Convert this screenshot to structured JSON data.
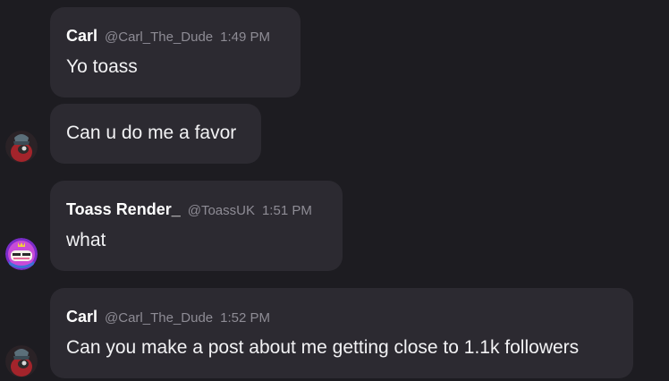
{
  "messages": [
    {
      "name": "Carl",
      "handle": "@Carl_The_Dude",
      "time": "1:49 PM",
      "text": "Yo toass"
    },
    {
      "text": "Can u do me a favor"
    },
    {
      "name": "Toass Render_",
      "handle": "@ToassUK",
      "time": "1:51 PM",
      "text": "what"
    },
    {
      "name": "Carl",
      "handle": "@Carl_The_Dude",
      "time": "1:52 PM",
      "text": "Can you make a post about me getting close to 1.1k followers"
    }
  ],
  "colors": {
    "background": "#1d1c21",
    "bubble": "#2c2a31",
    "name": "#ffffff",
    "meta": "#8e8c95",
    "text": "#f2f2f4"
  },
  "icons": {
    "carl_avatar": "carl-avatar-icon",
    "toass_avatar": "toass-avatar-icon"
  }
}
